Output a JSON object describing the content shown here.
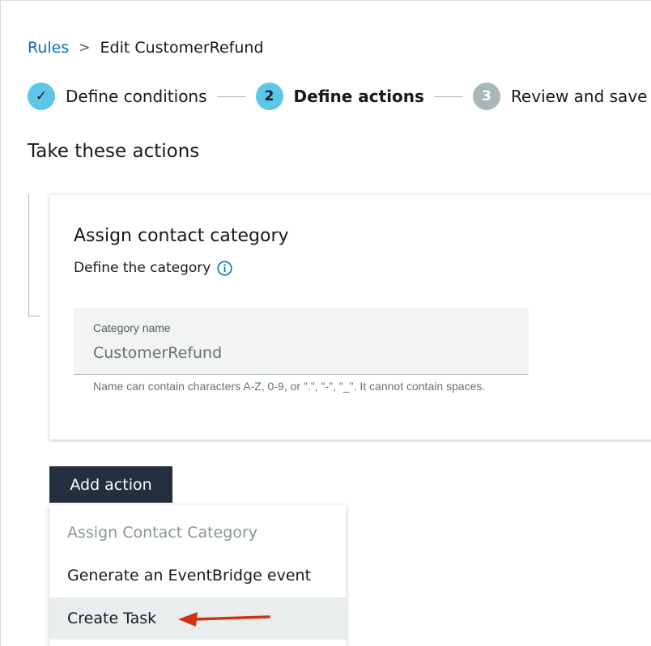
{
  "breadcrumb": {
    "link": "Rules",
    "separator": ">",
    "current": "Edit CustomerRefund"
  },
  "stepper": {
    "steps": [
      {
        "marker": "✓",
        "label": "Define conditions",
        "state": "done"
      },
      {
        "marker": "2",
        "label": "Define actions",
        "state": "active"
      },
      {
        "marker": "3",
        "label": "Review and save",
        "state": "pending"
      }
    ]
  },
  "section_title": "Take these actions",
  "card": {
    "title": "Assign contact category",
    "subtitle": "Define the category",
    "field": {
      "label": "Category name",
      "value": "CustomerRefund",
      "hint": "Name can contain characters A-Z, 0-9, or \".\", \"-\", \"_\". It cannot contain spaces."
    }
  },
  "add_action": {
    "button_label": "Add action",
    "menu_items": [
      {
        "label": "Assign Contact Category",
        "state": "disabled"
      },
      {
        "label": "Generate an EventBridge event",
        "state": "normal"
      },
      {
        "label": "Create Task",
        "state": "highlighted"
      }
    ]
  },
  "colors": {
    "link": "#0073bb",
    "step_active": "#5bc6e8",
    "step_pending": "#aab7b8",
    "button_bg": "#232f3e",
    "arrow": "#d13212"
  }
}
